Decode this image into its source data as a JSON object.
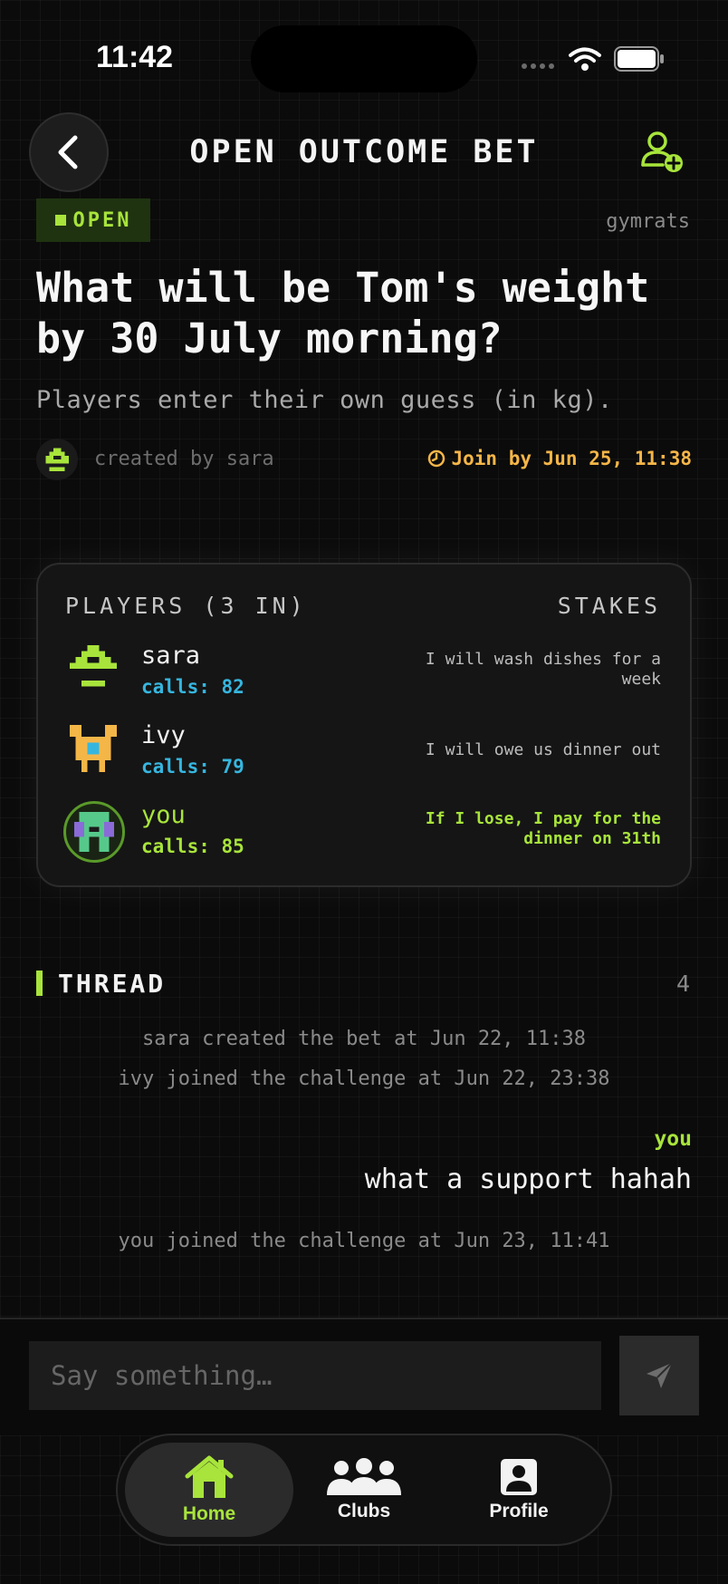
{
  "status_bar": {
    "time": "11:42"
  },
  "header": {
    "title": "OPEN OUTCOME BET"
  },
  "bet": {
    "status": "OPEN",
    "club": "gymrats",
    "question": "What will be Tom's weight by 30 July morning?",
    "subtitle": "Players enter their own guess (in kg).",
    "creator": "created by sara",
    "join_by": "Join by Jun 25, 11:38"
  },
  "players_card": {
    "heading": "PLAYERS (3 IN)",
    "stakes_heading": "STAKES",
    "players": [
      {
        "name": "sara",
        "call": "calls: 82",
        "stake": "I will wash dishes for a week"
      },
      {
        "name": "ivy",
        "call": "calls: 79",
        "stake": "I will owe us dinner out"
      },
      {
        "name": "you",
        "call": "calls: 85",
        "stake": "If I lose, I pay for the dinner on 31th"
      }
    ]
  },
  "thread": {
    "title": "THREAD",
    "count": "4",
    "messages": [
      {
        "type": "system",
        "text": "sara created the bet at Jun 22, 11:38"
      },
      {
        "type": "system",
        "text": "ivy joined the challenge at Jun 22, 23:38"
      },
      {
        "type": "user",
        "author": "you",
        "text": "what a support hahah"
      },
      {
        "type": "system",
        "text": "you joined the challenge at Jun 23, 11:41"
      }
    ]
  },
  "composer": {
    "placeholder": "Say something…",
    "value": ""
  },
  "tabbar": {
    "home": "Home",
    "clubs": "Clubs",
    "profile": "Profile",
    "active": "home"
  },
  "colors": {
    "accent": "#a8e43b",
    "warning": "#f5b648",
    "call_blue": "#36b6df",
    "background": "#0b0b0b"
  }
}
